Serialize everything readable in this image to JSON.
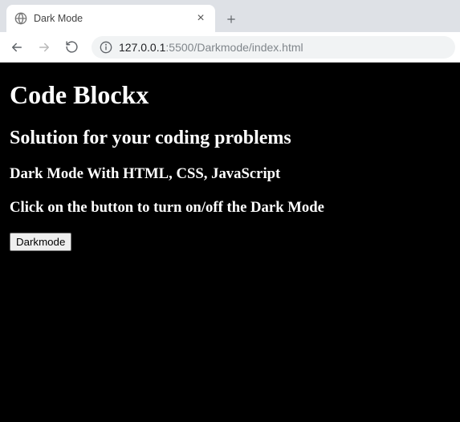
{
  "browser": {
    "tab_title": "Dark Mode",
    "url_host": "127.0.0.1",
    "url_port": ":5500",
    "url_path": "/Darkmode/index.html"
  },
  "page": {
    "h1": "Code Blockx",
    "h2": "Solution for your coding problems",
    "h3": "Dark Mode With HTML, CSS, JavaScript",
    "instruction": "Click on the button to turn on/off the Dark Mode",
    "button_label": "Darkmode"
  }
}
